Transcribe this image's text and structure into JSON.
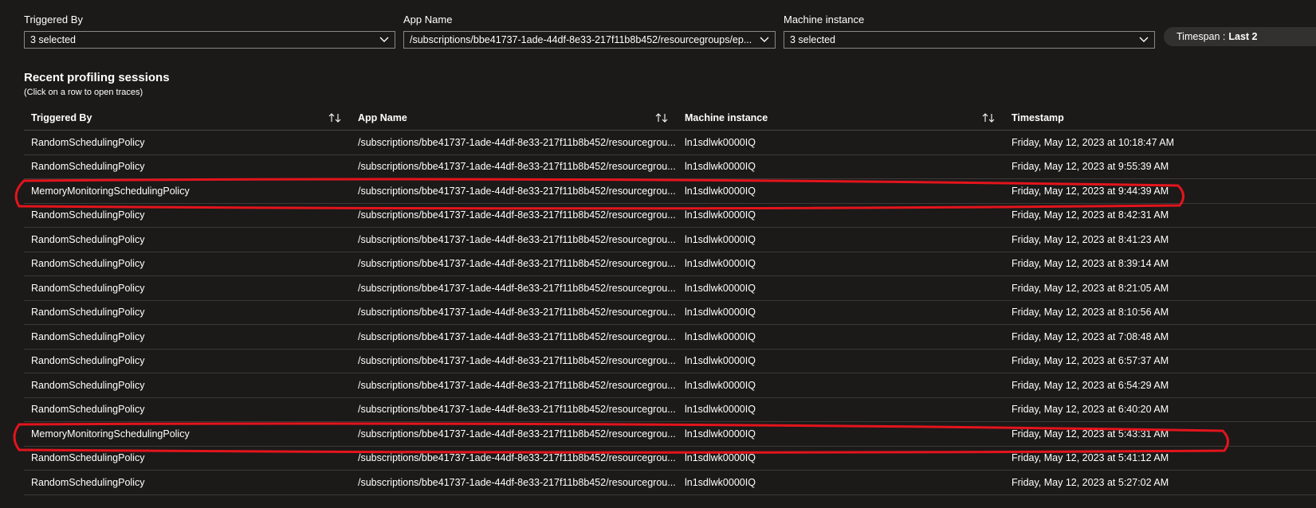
{
  "filters": {
    "triggered_by": {
      "label": "Triggered By",
      "value": "3 selected"
    },
    "app_name": {
      "label": "App Name",
      "value": "/subscriptions/bbe41737-1ade-44df-8e33-217f11b8b452/resourcegroups/ep..."
    },
    "machine_instance": {
      "label": "Machine instance",
      "value": "3 selected"
    },
    "timespan": {
      "label": "Timespan :",
      "value": "Last 2"
    }
  },
  "section": {
    "title": "Recent profiling sessions",
    "subtitle": "(Click on a row to open traces)"
  },
  "table": {
    "columns": [
      "Triggered By",
      "App Name",
      "Machine instance",
      "Timestamp"
    ],
    "rows": [
      {
        "triggered_by": "RandomSchedulingPolicy",
        "app_name": "/subscriptions/bbe41737-1ade-44df-8e33-217f11b8b452/resourcegrou...",
        "machine": "ln1sdlwk0000IQ",
        "timestamp": "Friday, May 12, 2023 at 10:18:47 AM"
      },
      {
        "triggered_by": "RandomSchedulingPolicy",
        "app_name": "/subscriptions/bbe41737-1ade-44df-8e33-217f11b8b452/resourcegrou...",
        "machine": "ln1sdlwk0000IQ",
        "timestamp": "Friday, May 12, 2023 at 9:55:39 AM"
      },
      {
        "triggered_by": "MemoryMonitoringSchedulingPolicy",
        "app_name": "/subscriptions/bbe41737-1ade-44df-8e33-217f11b8b452/resourcegrou...",
        "machine": "ln1sdlwk0000IQ",
        "timestamp": "Friday, May 12, 2023 at 9:44:39 AM"
      },
      {
        "triggered_by": "RandomSchedulingPolicy",
        "app_name": "/subscriptions/bbe41737-1ade-44df-8e33-217f11b8b452/resourcegrou...",
        "machine": "ln1sdlwk0000IQ",
        "timestamp": "Friday, May 12, 2023 at 8:42:31 AM"
      },
      {
        "triggered_by": "RandomSchedulingPolicy",
        "app_name": "/subscriptions/bbe41737-1ade-44df-8e33-217f11b8b452/resourcegrou...",
        "machine": "ln1sdlwk0000IQ",
        "timestamp": "Friday, May 12, 2023 at 8:41:23 AM"
      },
      {
        "triggered_by": "RandomSchedulingPolicy",
        "app_name": "/subscriptions/bbe41737-1ade-44df-8e33-217f11b8b452/resourcegrou...",
        "machine": "ln1sdlwk0000IQ",
        "timestamp": "Friday, May 12, 2023 at 8:39:14 AM"
      },
      {
        "triggered_by": "RandomSchedulingPolicy",
        "app_name": "/subscriptions/bbe41737-1ade-44df-8e33-217f11b8b452/resourcegrou...",
        "machine": "ln1sdlwk0000IQ",
        "timestamp": "Friday, May 12, 2023 at 8:21:05 AM"
      },
      {
        "triggered_by": "RandomSchedulingPolicy",
        "app_name": "/subscriptions/bbe41737-1ade-44df-8e33-217f11b8b452/resourcegrou...",
        "machine": "ln1sdlwk0000IQ",
        "timestamp": "Friday, May 12, 2023 at 8:10:56 AM"
      },
      {
        "triggered_by": "RandomSchedulingPolicy",
        "app_name": "/subscriptions/bbe41737-1ade-44df-8e33-217f11b8b452/resourcegrou...",
        "machine": "ln1sdlwk0000IQ",
        "timestamp": "Friday, May 12, 2023 at 7:08:48 AM"
      },
      {
        "triggered_by": "RandomSchedulingPolicy",
        "app_name": "/subscriptions/bbe41737-1ade-44df-8e33-217f11b8b452/resourcegrou...",
        "machine": "ln1sdlwk0000IQ",
        "timestamp": "Friday, May 12, 2023 at 6:57:37 AM"
      },
      {
        "triggered_by": "RandomSchedulingPolicy",
        "app_name": "/subscriptions/bbe41737-1ade-44df-8e33-217f11b8b452/resourcegrou...",
        "machine": "ln1sdlwk0000IQ",
        "timestamp": "Friday, May 12, 2023 at 6:54:29 AM"
      },
      {
        "triggered_by": "RandomSchedulingPolicy",
        "app_name": "/subscriptions/bbe41737-1ade-44df-8e33-217f11b8b452/resourcegrou...",
        "machine": "ln1sdlwk0000IQ",
        "timestamp": "Friday, May 12, 2023 at 6:40:20 AM"
      },
      {
        "triggered_by": "MemoryMonitoringSchedulingPolicy",
        "app_name": "/subscriptions/bbe41737-1ade-44df-8e33-217f11b8b452/resourcegrou...",
        "machine": "ln1sdlwk0000IQ",
        "timestamp": "Friday, May 12, 2023 at 5:43:31 AM"
      },
      {
        "triggered_by": "RandomSchedulingPolicy",
        "app_name": "/subscriptions/bbe41737-1ade-44df-8e33-217f11b8b452/resourcegrou...",
        "machine": "ln1sdlwk0000IQ",
        "timestamp": "Friday, May 12, 2023 at 5:41:12 AM"
      },
      {
        "triggered_by": "RandomSchedulingPolicy",
        "app_name": "/subscriptions/bbe41737-1ade-44df-8e33-217f11b8b452/resourcegrou...",
        "machine": "ln1sdlwk0000IQ",
        "timestamp": "Friday, May 12, 2023 at 5:27:02 AM"
      }
    ]
  },
  "icons": {
    "dropdown": "chevron-down-icon",
    "sort": "sort-arrows-icon"
  },
  "colors": {
    "background": "#1b1a19",
    "border": "#8a8886",
    "highlight": "#e3141c",
    "pill": "#323130"
  }
}
